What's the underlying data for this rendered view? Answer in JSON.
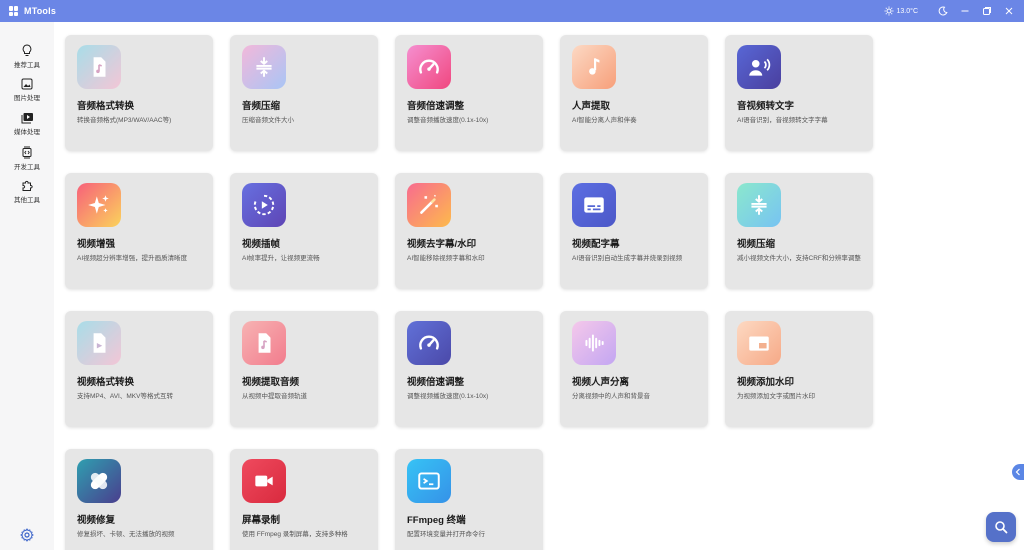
{
  "app": {
    "title": "MTools"
  },
  "titlebar": {
    "weather": "13.0°C"
  },
  "sidebar": {
    "items": [
      {
        "label": "推荐工具",
        "icon": "lightbulb-icon"
      },
      {
        "label": "图片处理",
        "icon": "image-icon"
      },
      {
        "label": "媒体处理",
        "icon": "media-icon"
      },
      {
        "label": "开发工具",
        "icon": "code-icon"
      },
      {
        "label": "其他工具",
        "icon": "puzzle-icon"
      }
    ],
    "settings_icon": "gear-icon"
  },
  "cards": [
    {
      "title": "音频格式转换",
      "desc": "转换音频格式(MP3/WAV/AAC等)",
      "icon": "audio-file-icon",
      "colors": [
        "#a8dde8",
        "#f3c6d6"
      ]
    },
    {
      "title": "音频压缩",
      "desc": "压缩音频文件大小",
      "icon": "compress-icon",
      "colors": [
        "#f2b8da",
        "#a9c5f5"
      ]
    },
    {
      "title": "音频倍速调整",
      "desc": "调整音频播放速度(0.1x-10x)",
      "icon": "speed-icon",
      "colors": [
        "#f58fd0",
        "#f0477f"
      ]
    },
    {
      "title": "人声提取",
      "desc": "AI智能分离人声和伴奏",
      "icon": "music-note-icon",
      "colors": [
        "#fcd9c4",
        "#f79f7a"
      ]
    },
    {
      "title": "音视频转文字",
      "desc": "AI语音识别，音视频转文字字幕",
      "icon": "speech-icon",
      "colors": [
        "#5867d6",
        "#4a3f9e"
      ]
    },
    {
      "title": "视频增强",
      "desc": "AI视频超分辨率增强，提升画质清晰度",
      "icon": "sparkle-icon",
      "colors": [
        "#f7607a",
        "#fbd35c"
      ]
    },
    {
      "title": "视频插帧",
      "desc": "AI帧率提升，让视频更流畅",
      "icon": "play-circle-icon",
      "colors": [
        "#6770e0",
        "#5e45b5"
      ]
    },
    {
      "title": "视频去字幕/水印",
      "desc": "AI智能移除视频字幕和水印",
      "icon": "magic-wand-icon",
      "colors": [
        "#f86b8f",
        "#fdba4c"
      ]
    },
    {
      "title": "视频配字幕",
      "desc": "AI语音识别自动生成字幕并烧录到视频",
      "icon": "subtitles-icon",
      "colors": [
        "#5c6ee2",
        "#4c58c8"
      ]
    },
    {
      "title": "视频压缩",
      "desc": "减小视频文件大小，支持CRF和分辨率调整",
      "icon": "compress-icon",
      "colors": [
        "#8be8cd",
        "#77c3f2"
      ]
    },
    {
      "title": "视频格式转换",
      "desc": "支持MP4、AVI、MKV等格式互转",
      "icon": "video-file-icon",
      "colors": [
        "#a8dde8",
        "#f3c6d6"
      ]
    },
    {
      "title": "视频提取音频",
      "desc": "从视频中提取音频轨道",
      "icon": "audio-file-icon",
      "colors": [
        "#f7b3b3",
        "#f27c8d"
      ]
    },
    {
      "title": "视频倍速调整",
      "desc": "调整视频播放速度(0.1x-10x)",
      "icon": "speed-icon",
      "colors": [
        "#6171d8",
        "#4b49a9"
      ]
    },
    {
      "title": "视频人声分离",
      "desc": "分离视频中的人声和背景音",
      "icon": "waveform-icon",
      "colors": [
        "#f5c8ea",
        "#c3a6f2"
      ]
    },
    {
      "title": "视频添加水印",
      "desc": "为视频添加文字或图片水印",
      "icon": "watermark-icon",
      "colors": [
        "#fdd9c2",
        "#f6a987"
      ]
    },
    {
      "title": "视频修复",
      "desc": "修复损坏、卡顿、无法播放的视频",
      "icon": "bandage-icon",
      "colors": [
        "#2f9fb0",
        "#4a3e8e"
      ]
    },
    {
      "title": "屏幕录制",
      "desc": "使用 FFmpeg 录制屏幕，支持多种格",
      "icon": "video-camera-icon",
      "colors": [
        "#ef4a5e",
        "#d92a3e"
      ]
    },
    {
      "title": "FFmpeg 终端",
      "desc": "配置环境变量并打开命令行",
      "icon": "terminal-icon",
      "colors": [
        "#37c3f5",
        "#3592e8"
      ]
    }
  ],
  "colors": {
    "titlebar": "#6b86e6",
    "accent": "#5b86e5",
    "fab": "#5571c9"
  }
}
